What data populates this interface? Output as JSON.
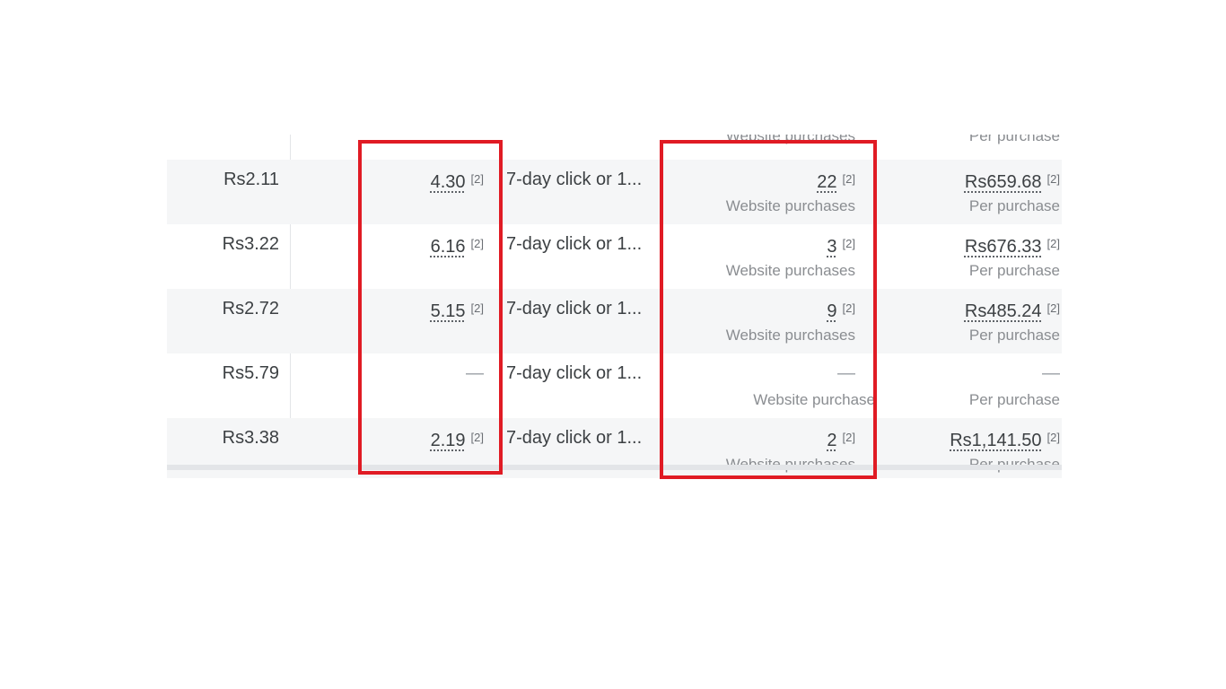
{
  "top_partial": {
    "results_label": "Website purchases",
    "cost_label": "Per purchase"
  },
  "rows": [
    {
      "cpc": "Rs2.11",
      "roas": "4.30",
      "roas_ref": "[2]",
      "attribution": "7-day click or 1...",
      "results": "22",
      "results_ref": "[2]",
      "results_label": "Website purchases",
      "cost": "Rs659.68",
      "cost_ref": "[2]",
      "cost_label": "Per purchase"
    },
    {
      "cpc": "Rs3.22",
      "roas": "6.16",
      "roas_ref": "[2]",
      "attribution": "7-day click or 1...",
      "results": "3",
      "results_ref": "[2]",
      "results_label": "Website purchases",
      "cost": "Rs676.33",
      "cost_ref": "[2]",
      "cost_label": "Per purchase"
    },
    {
      "cpc": "Rs2.72",
      "roas": "5.15",
      "roas_ref": "[2]",
      "attribution": "7-day click or 1...",
      "results": "9",
      "results_ref": "[2]",
      "results_label": "Website purchases",
      "cost": "Rs485.24",
      "cost_ref": "[2]",
      "cost_label": "Per purchase"
    },
    {
      "cpc": "Rs5.79",
      "roas": "—",
      "roas_ref": "",
      "attribution": "7-day click or 1...",
      "results": "—",
      "results_ref": "",
      "results_label": "Website purchase",
      "cost": "—",
      "cost_ref": "",
      "cost_label": "Per purchase"
    },
    {
      "cpc": "Rs3.38",
      "roas": "2.19",
      "roas_ref": "[2]",
      "attribution": "7-day click or 1...",
      "results": "2",
      "results_ref": "[2]",
      "results_label": "Website purchases",
      "cost": "Rs1,141.50",
      "cost_ref": "[2]",
      "cost_label": "Per purchase"
    }
  ],
  "colors": {
    "highlight": "#e01b24",
    "row_shade": "#f5f6f7",
    "text": "#3c4043",
    "muted_text": "#8a8d91"
  }
}
